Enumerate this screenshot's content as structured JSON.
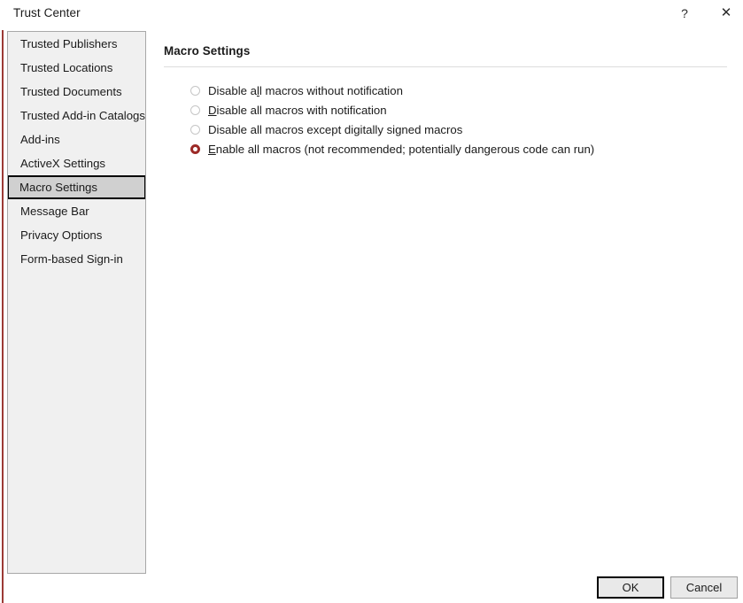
{
  "window": {
    "title": "Trust Center",
    "accent_color": "#9c3a36",
    "background": "#ffffff"
  },
  "titlebar": {
    "help_glyph": "?",
    "close_glyph": "✕"
  },
  "sidebar": {
    "background": "#f0f0f0",
    "selected_index": 6,
    "items": [
      {
        "label": "Trusted Publishers"
      },
      {
        "label": "Trusted Locations"
      },
      {
        "label": "Trusted Documents"
      },
      {
        "label": "Trusted Add-in Catalogs"
      },
      {
        "label": "Add-ins"
      },
      {
        "label": "ActiveX Settings"
      },
      {
        "label": "Macro Settings"
      },
      {
        "label": "Message Bar"
      },
      {
        "label": "Privacy Options"
      },
      {
        "label": "Form-based Sign-in"
      }
    ]
  },
  "main": {
    "section_title": "Macro Settings",
    "radio_selected_color": "#9c2a27",
    "options": [
      {
        "label": "Disable all macros without notification",
        "pre": "Disable a",
        "accel": "l",
        "post": "l macros without notification",
        "checked": false
      },
      {
        "label": "Disable all macros with notification",
        "pre": "",
        "accel": "D",
        "post": "isable all macros with notification",
        "checked": false
      },
      {
        "label": "Disable all macros except digitally signed macros",
        "pre": "Disable all macros except di",
        "accel": "g",
        "post": "itally signed macros",
        "checked": false
      },
      {
        "label": "Enable all macros (not recommended; potentially dangerous code can run)",
        "pre": "",
        "accel": "E",
        "post": "nable all macros (not recommended; potentially dangerous code can run)",
        "checked": true
      }
    ]
  },
  "footer": {
    "ok_label": "OK",
    "cancel_label": "Cancel"
  }
}
